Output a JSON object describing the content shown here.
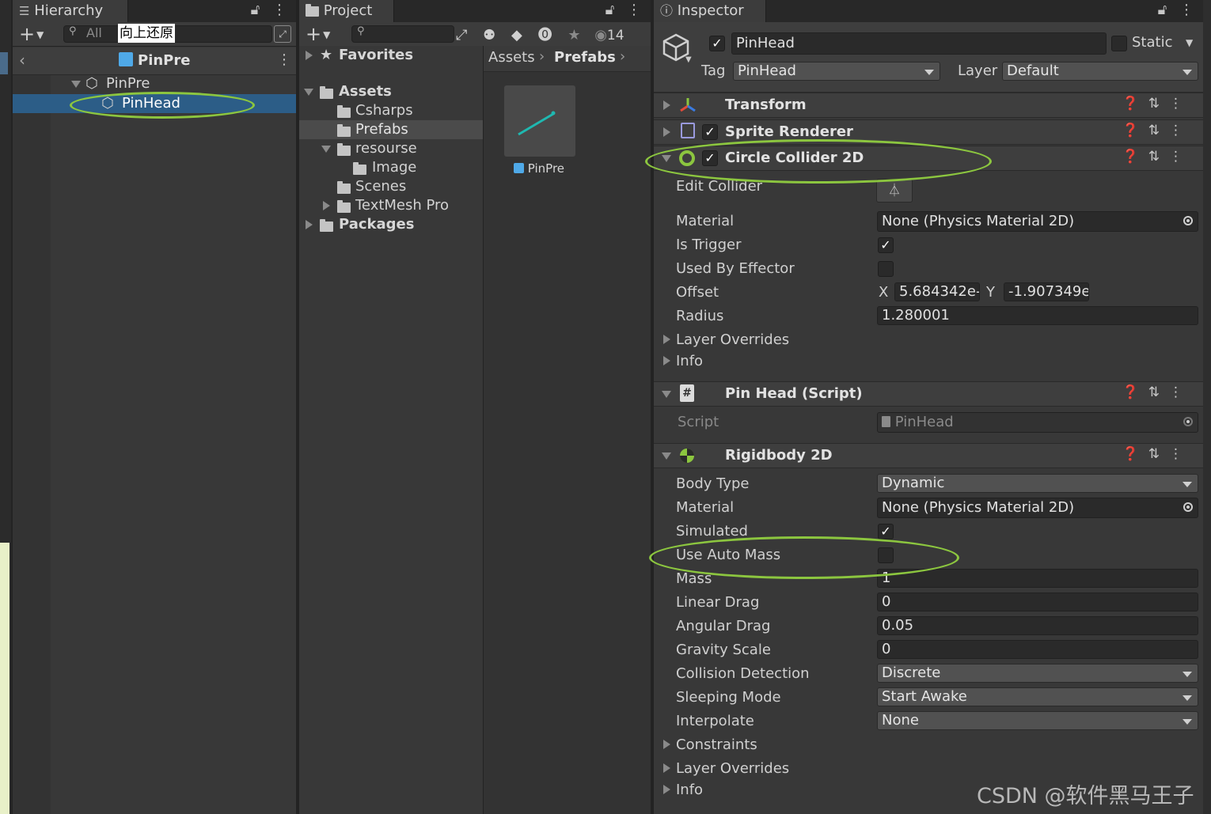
{
  "hierarchy": {
    "tab": "Hierarchy",
    "search_prefix": "All",
    "ime_text": "向上还原",
    "breadcrumb": "PinPre",
    "items": [
      "PinPre",
      "PinHead"
    ]
  },
  "project": {
    "tab": "Project",
    "favorites": "Favorites",
    "assets": "Assets",
    "folders": [
      "Csharps",
      "Prefabs",
      "resourse",
      "Image",
      "Scenes",
      "TextMesh Pro"
    ],
    "packages": "Packages",
    "path_root": "Assets",
    "path_current": "Prefabs",
    "hidden_count": "14",
    "asset_name": "PinPre"
  },
  "inspector": {
    "tab": "Inspector",
    "object_name": "PinHead",
    "static_label": "Static",
    "tag_label": "Tag",
    "tag_value": "PinHead",
    "layer_label": "Layer",
    "layer_value": "Default",
    "components": {
      "transform": "Transform",
      "sprite_renderer": "Sprite Renderer",
      "circle_collider": "Circle Collider 2D",
      "pinhead_script": "Pin Head (Script)",
      "rigidbody": "Rigidbody 2D"
    },
    "collider": {
      "edit_collider": "Edit Collider",
      "material_label": "Material",
      "material_value": "None (Physics Material 2D)",
      "is_trigger": "Is Trigger",
      "used_by_effector": "Used By Effector",
      "offset": "Offset",
      "x_label": "X",
      "x_value": "5.684342e-",
      "y_label": "Y",
      "y_value": "-1.907349e",
      "radius": "Radius",
      "radius_value": "1.280001",
      "layer_overrides": "Layer Overrides",
      "info": "Info"
    },
    "script": {
      "label": "Script",
      "value": "PinHead"
    },
    "rigidbody": {
      "body_type": "Body Type",
      "body_type_value": "Dynamic",
      "material": "Material",
      "material_value": "None (Physics Material 2D)",
      "simulated": "Simulated",
      "use_auto_mass": "Use Auto Mass",
      "mass": "Mass",
      "mass_value": "1",
      "linear_drag": "Linear Drag",
      "linear_drag_value": "0",
      "angular_drag": "Angular Drag",
      "angular_drag_value": "0.05",
      "gravity_scale": "Gravity Scale",
      "gravity_scale_value": "0",
      "collision_detection": "Collision Detection",
      "collision_detection_value": "Discrete",
      "sleeping_mode": "Sleeping Mode",
      "sleeping_mode_value": "Start Awake",
      "interpolate": "Interpolate",
      "interpolate_value": "None",
      "constraints": "Constraints",
      "layer_overrides": "Layer Overrides",
      "info": "Info"
    }
  },
  "watermark": "CSDN @软件黑马王子",
  "colors": {
    "highlight_ellipse": "#8cc63f",
    "selection": "#2c5d87",
    "prefab_blue": "#4fa9e8"
  }
}
